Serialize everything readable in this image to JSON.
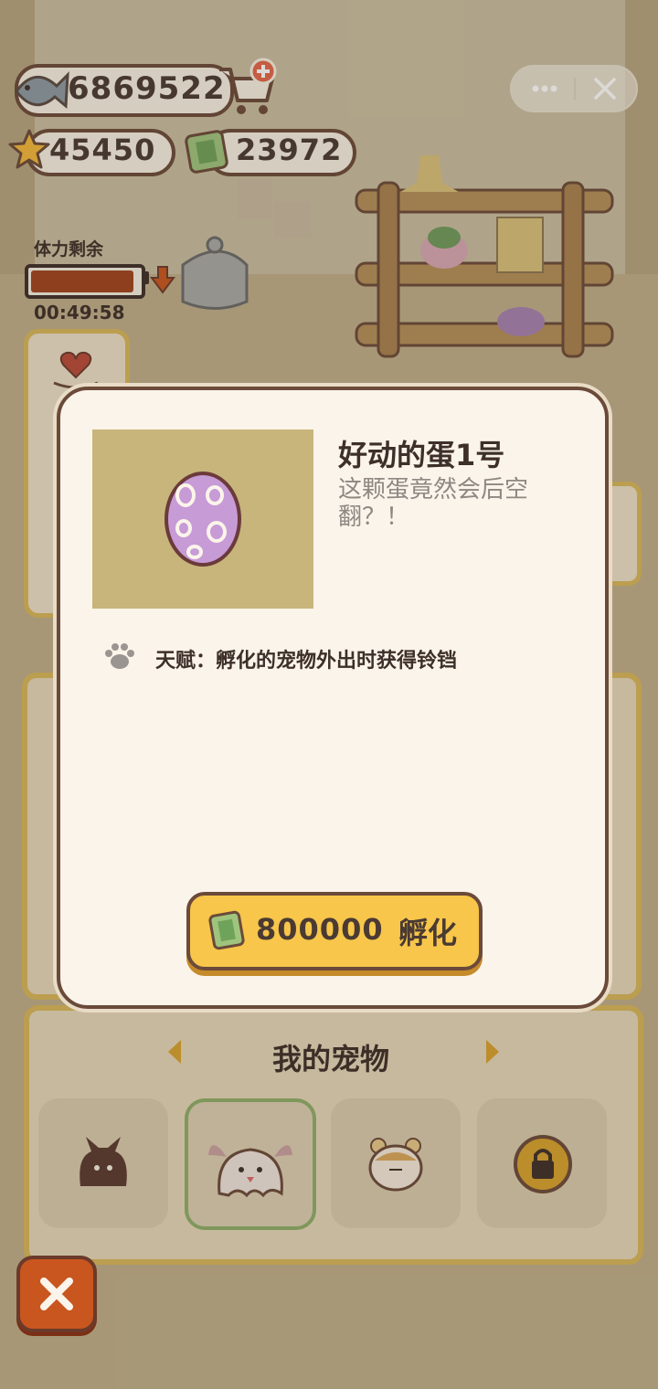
{
  "currencies": {
    "fish": "6869522",
    "stars": "45450",
    "tickets": "23972"
  },
  "stamina": {
    "label": "体力剩余",
    "timer": "00:49:58",
    "level": 0.9
  },
  "dialog": {
    "title": "好动的蛋1号",
    "description": "这颗蛋竟然会后空翻？！",
    "talent": "天赋：孵化的宠物外出时获得铃铛",
    "hatch_price": "800000",
    "hatch_label": "孵化"
  },
  "pets": {
    "title": "我的宠物"
  },
  "colors": {
    "accent": "#f7c64a",
    "outline": "#6b4a3a",
    "egg": "#c79bd6",
    "dialog_bg": "#fbf4ea",
    "close": "#c9561f"
  },
  "icons": [
    "fish-icon",
    "cart-plus-icon",
    "star-icon",
    "ticket-icon",
    "more-icon",
    "close-icon",
    "paw-icon",
    "lock-icon"
  ]
}
